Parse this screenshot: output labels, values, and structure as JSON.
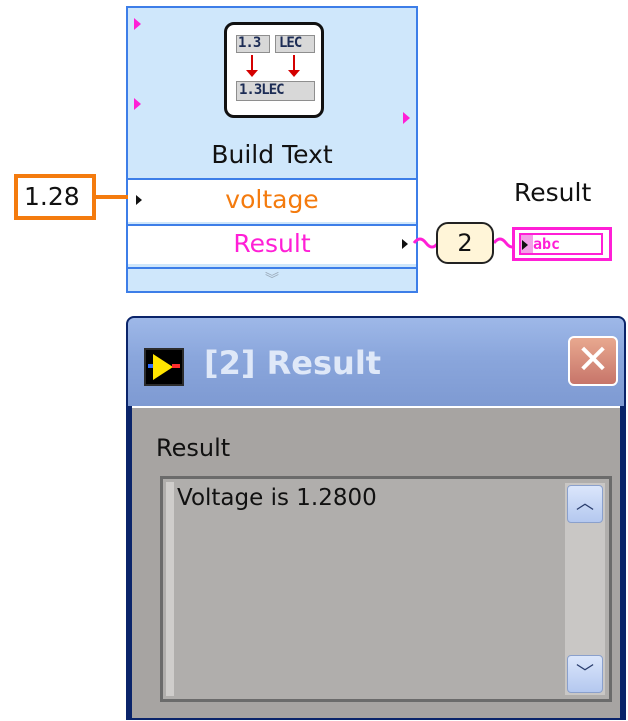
{
  "block_diagram": {
    "express_vi": {
      "title": "Build Text",
      "icon_top_left": "1.3",
      "icon_top_right": "LEC",
      "icon_bottom": "1.3LEC",
      "input_terminal": "voltage",
      "output_terminal": "Result"
    },
    "constant_value": "1.28",
    "probe_number": "2",
    "indicator_label": "Result",
    "indicator_type": "abc"
  },
  "probe_window": {
    "title": "[2] Result",
    "control_label": "Result",
    "text_value": "Voltage is 1.2800"
  },
  "colors": {
    "node_fill": "#cfe7fb",
    "node_border": "#3d7ee8",
    "numeric_wire": "#f47b0e",
    "string_wire": "#ff1fd6",
    "window_title_bg": "#8aa6dc",
    "window_body": "#a7a4a2"
  },
  "icons": [
    "build-text-icon",
    "scroll-up-icon",
    "scroll-down-icon",
    "close-icon",
    "vi-probe-icon"
  ]
}
